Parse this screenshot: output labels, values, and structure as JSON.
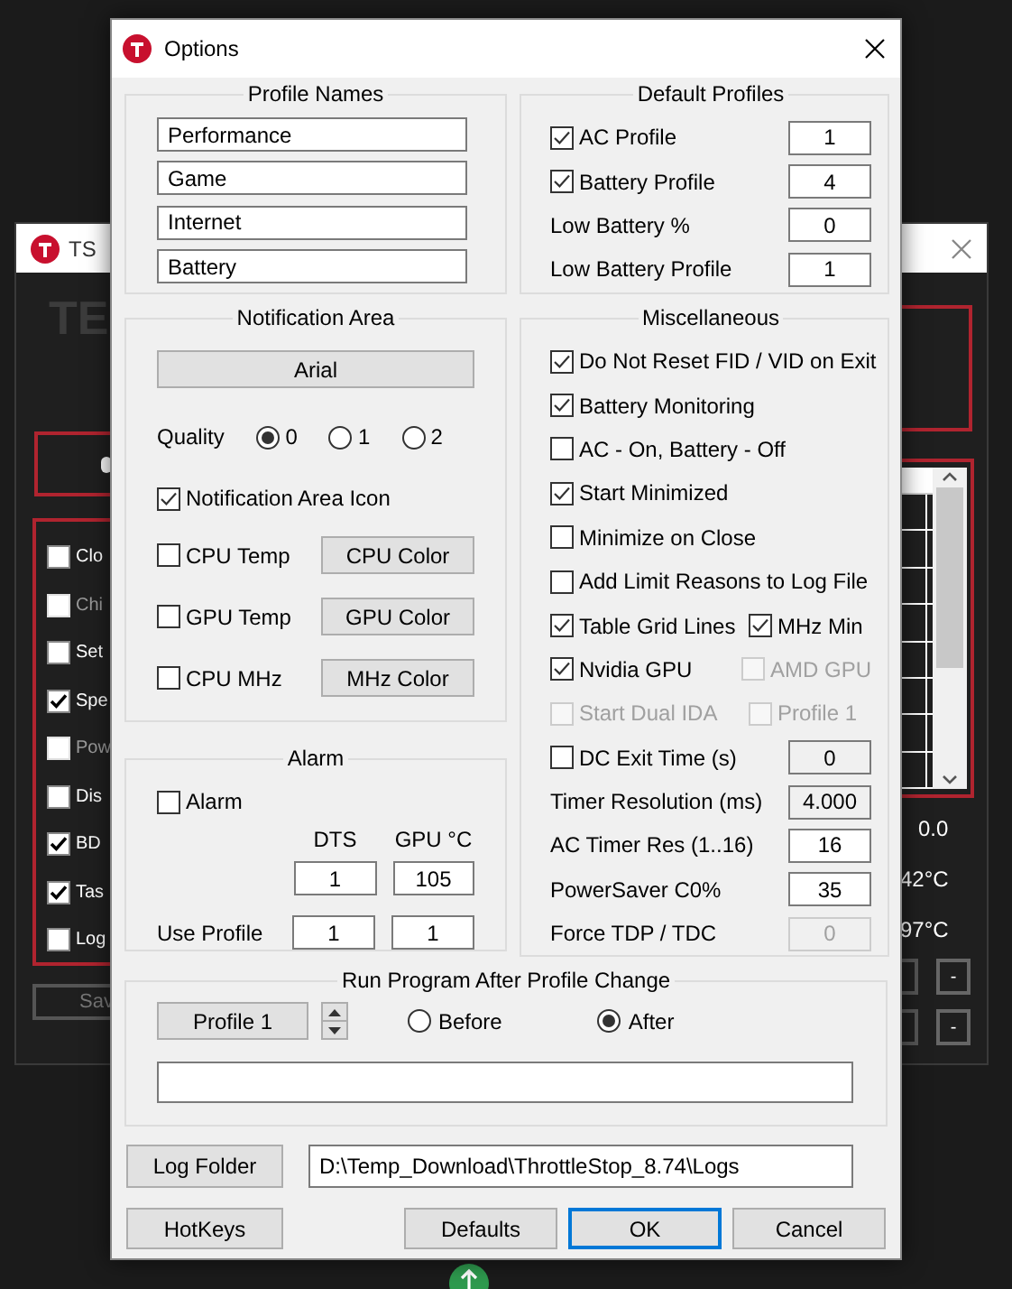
{
  "background_window": {
    "title": "TS",
    "heading": "TE",
    "options": [
      {
        "label": "Clo",
        "checked": false,
        "disabled": false
      },
      {
        "label": "Chi",
        "checked": false,
        "disabled": true
      },
      {
        "label": "Set",
        "checked": false,
        "disabled": false
      },
      {
        "label": "Spe",
        "checked": true,
        "disabled": false
      },
      {
        "label": "Pow",
        "checked": false,
        "disabled": true
      },
      {
        "label": "Dis",
        "checked": false,
        "disabled": false
      },
      {
        "label": "BD",
        "checked": true,
        "disabled": false
      },
      {
        "label": "Tas",
        "checked": true,
        "disabled": false
      },
      {
        "label": "Log",
        "checked": false,
        "disabled": false
      }
    ],
    "save_button": "Sav",
    "readings": [
      "0.0",
      "42°C",
      "97°C"
    ],
    "buttons": [
      "-",
      "-"
    ]
  },
  "dialog": {
    "title": "Options",
    "profile_names": {
      "title": "Profile Names",
      "fields": [
        "Performance",
        "Game",
        "Internet",
        "Battery"
      ]
    },
    "notification_area": {
      "title": "Notification Area",
      "font_button": "Arial",
      "quality_label": "Quality",
      "quality": [
        {
          "label": "0",
          "selected": true
        },
        {
          "label": "1",
          "selected": false
        },
        {
          "label": "2",
          "selected": false
        }
      ],
      "icon": {
        "label": "Notification Area Icon",
        "checked": true
      },
      "items": [
        {
          "label": "CPU Temp",
          "checked": false,
          "button": "CPU Color"
        },
        {
          "label": "GPU Temp",
          "checked": false,
          "button": "GPU Color"
        },
        {
          "label": "CPU MHz",
          "checked": false,
          "button": "MHz Color"
        }
      ]
    },
    "alarm": {
      "title": "Alarm",
      "alarm": {
        "label": "Alarm",
        "checked": false
      },
      "columns": [
        "DTS",
        "GPU °C"
      ],
      "values": [
        "1",
        "105"
      ],
      "use_profile_label": "Use Profile",
      "use_profile": [
        "1",
        "1"
      ]
    },
    "default_profiles": {
      "title": "Default Profiles",
      "rows": [
        {
          "kind": "check",
          "label": "AC Profile",
          "checked": true,
          "value": "1"
        },
        {
          "kind": "check",
          "label": "Battery Profile",
          "checked": true,
          "value": "4"
        },
        {
          "kind": "text",
          "label": "Low Battery %",
          "value": "0"
        },
        {
          "kind": "text",
          "label": "Low Battery Profile",
          "value": "1"
        }
      ]
    },
    "miscellaneous": {
      "title": "Miscellaneous",
      "rows": [
        {
          "kind": "check",
          "items": [
            {
              "label": "Do Not Reset FID / VID on Exit",
              "checked": true,
              "disabled": false
            }
          ]
        },
        {
          "kind": "check",
          "items": [
            {
              "label": "Battery Monitoring",
              "checked": true,
              "disabled": false
            }
          ]
        },
        {
          "kind": "check",
          "items": [
            {
              "label": "AC - On, Battery - Off",
              "checked": false,
              "disabled": false
            }
          ]
        },
        {
          "kind": "check",
          "items": [
            {
              "label": "Start Minimized",
              "checked": true,
              "disabled": false
            }
          ]
        },
        {
          "kind": "check",
          "items": [
            {
              "label": "Minimize on Close",
              "checked": false,
              "disabled": false
            }
          ]
        },
        {
          "kind": "check",
          "items": [
            {
              "label": "Add Limit Reasons to Log File",
              "checked": false,
              "disabled": false
            }
          ]
        },
        {
          "kind": "check",
          "items": [
            {
              "label": "Table Grid Lines",
              "checked": true,
              "disabled": false
            },
            {
              "label": "MHz Min",
              "checked": true,
              "disabled": false
            }
          ]
        },
        {
          "kind": "check",
          "items": [
            {
              "label": "Nvidia GPU",
              "checked": true,
              "disabled": false
            },
            {
              "label": "AMD GPU",
              "checked": false,
              "disabled": true
            }
          ]
        },
        {
          "kind": "check",
          "items": [
            {
              "label": "Start Dual IDA",
              "checked": false,
              "disabled": true
            },
            {
              "label": "Profile 1",
              "checked": false,
              "disabled": true
            }
          ]
        },
        {
          "kind": "check_field",
          "label": "DC Exit Time (s)",
          "checked": false,
          "value": "0",
          "readonly": true,
          "disabled": false
        },
        {
          "kind": "field",
          "label": "Timer Resolution (ms)",
          "value": "4.000",
          "readonly": true,
          "disabled": false
        },
        {
          "kind": "field",
          "label": "AC Timer Res (1..16)",
          "value": "16",
          "readonly": false,
          "disabled": false
        },
        {
          "kind": "field",
          "label": "PowerSaver C0%",
          "value": "35",
          "readonly": false,
          "disabled": false
        },
        {
          "kind": "field",
          "label": "Force TDP / TDC",
          "value": "0",
          "readonly": false,
          "disabled": true
        }
      ]
    },
    "run_program": {
      "title": "Run Program After Profile Change",
      "profile_button": "Profile 1",
      "timing": [
        {
          "label": "Before",
          "selected": false
        },
        {
          "label": "After",
          "selected": true
        }
      ]
    },
    "log_folder": {
      "button": "Log Folder",
      "path": "D:\\Temp_Download\\ThrottleStop_8.74\\Logs"
    },
    "hotkeys_button": "HotKeys",
    "buttons": [
      {
        "label": "Defaults",
        "default": false
      },
      {
        "label": "OK",
        "default": true
      },
      {
        "label": "Cancel",
        "default": false
      }
    ]
  }
}
